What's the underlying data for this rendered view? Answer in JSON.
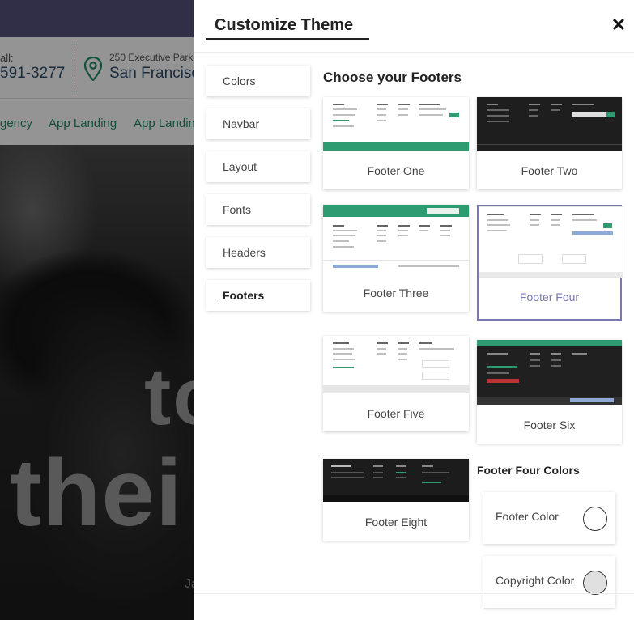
{
  "background_site": {
    "call_label": "all:",
    "phone": "591-3277",
    "address_line1": "250 Executive Park E",
    "address_line2": "San Francisco",
    "menu": [
      "gency",
      "App Landing",
      "App Landin"
    ],
    "hero_big_line1": "to",
    "hero_big_line2": "thei",
    "hero_small": "Ja"
  },
  "panel": {
    "title": "Customize Theme",
    "close_glyph": "✕",
    "nav": [
      {
        "label": "Colors"
      },
      {
        "label": "Navbar"
      },
      {
        "label": "Layout"
      },
      {
        "label": "Fonts"
      },
      {
        "label": "Headers"
      },
      {
        "label": "Footers",
        "active": true
      }
    ],
    "section_title": "Choose your Footers",
    "footers": [
      {
        "label": "Footer One",
        "style": "light-green-bar"
      },
      {
        "label": "Footer Two",
        "style": "dark"
      },
      {
        "label": "Footer Three",
        "style": "green-top-light"
      },
      {
        "label": "Footer Four",
        "style": "light",
        "selected": true
      },
      {
        "label": "Footer Five",
        "style": "light-gray-bar"
      },
      {
        "label": "Footer Six",
        "style": "dark-green-top"
      },
      {
        "label": "Footer Eight",
        "style": "dark-short"
      }
    ],
    "colors_title": "Footer Four Colors",
    "color_settings": [
      {
        "label": "Footer Color",
        "value": "#ffffff"
      },
      {
        "label": "Copyright Color",
        "value": "#e0e0e0"
      }
    ],
    "accent": "#7a78b0",
    "brand_green": "#2f9b70"
  }
}
